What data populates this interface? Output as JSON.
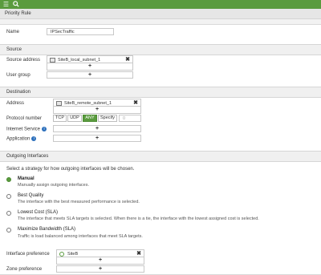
{
  "header": {
    "menu_icon": "hamburger-menu-icon",
    "search_icon": "search-icon",
    "accent": "#5a9b3e"
  },
  "page": {
    "title": "Priority Rule"
  },
  "name": {
    "label": "Name",
    "value": "IPSecTraffic"
  },
  "source": {
    "section_title": "Source",
    "address_label": "Source address",
    "address_value": "SiteB_local_subnet_1",
    "user_group_label": "User group"
  },
  "destination": {
    "section_title": "Destination",
    "address_label": "Address",
    "address_value": "SiteB_remote_subnet_1",
    "protocol_label": "Protocol number",
    "protocols": [
      "TCP",
      "UDP",
      "ANY",
      "Specify"
    ],
    "selected_protocol": "ANY",
    "protocol_number": "0",
    "internet_service_label": "Internet Service",
    "application_label": "Application"
  },
  "outgoing": {
    "section_title": "Outgoing Interfaces",
    "instruction": "Select a strategy for how outgoing interfaces will be chosen.",
    "options": [
      {
        "title": "Manual",
        "desc": "Manually assign outgoing interfaces.",
        "selected": true
      },
      {
        "title": "Best Quality",
        "desc": "The interface with the best measured performance is selected.",
        "selected": false
      },
      {
        "title": "Lowest Cost (SLA)",
        "desc": "The interface that meets SLA targets is selected. When there is a tie, the interface with the lowest assigned cost is selected.",
        "selected": false
      },
      {
        "title": "Maximize Bandwidth (SLA)",
        "desc": "Traffic is load balanced among interfaces that meet SLA targets.",
        "selected": false
      }
    ],
    "interface_pref_label": "Interface preference",
    "interface_value": "SiteB",
    "zone_pref_label": "Zone preference"
  }
}
